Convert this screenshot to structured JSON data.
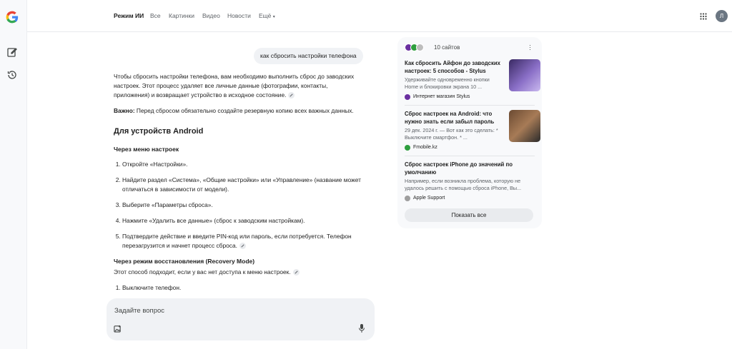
{
  "nav": {
    "tabs": [
      "Режим ИИ",
      "Все",
      "Картинки",
      "Видео",
      "Новости",
      "Ещё"
    ],
    "avatar_letter": "Л"
  },
  "query": "как сбросить настройки телефона",
  "answer": {
    "intro": "Чтобы сбросить настройки телефона, вам необходимо выполнить сброс до заводских настроек. Этот процесс удаляет все личные данные (фотографии, контакты, приложения) и возвращает устройство в исходное состояние.",
    "important_label": "Важно:",
    "important_text": " Перед сбросом обязательно создайте резервную копию всех важных данных.",
    "android_heading": "Для устройств Android",
    "menu_heading": "Через меню настроек",
    "steps": [
      "Откройте «Настройки».",
      "Найдите раздел «Система», «Общие настройки» или «Управление» (название может отличаться в зависимости от модели).",
      "Выберите «Параметры сброса».",
      "Нажмите «Удалить все данные» (сброс к заводским настройкам).",
      "Подтвердите действие и введите PIN-код или пароль, если потребуется. Телефон перезагрузится и начнет процесс сброса."
    ],
    "recovery_heading": "Через режим восстановления (Recovery Mode)",
    "recovery_intro": "Этот способ подходит, если у вас нет доступа к меню настроек.",
    "recovery_step1": "Выключите телефон."
  },
  "input": {
    "placeholder": "Задайте вопрос"
  },
  "sources": {
    "count_label": "10 сайтов",
    "cards": [
      {
        "title": "Как сбросить Айфон до заводских настроек: 5 способов - Stylus",
        "snippet": "Удерживайте одновременно кнопки Home и блокировки экрана 10 ...",
        "source": "Интернет магазин Stylus"
      },
      {
        "title": "Сброс настроек на Android: что нужно знать если забыл пароль",
        "snippet": "29 дек. 2024 г. — Вот как это сделать: * Выключите смартфон. * ...",
        "source": "Fmobile.kz"
      },
      {
        "title": "Сброс настроек iPhone до значений по умолчанию",
        "snippet": "Например, если возникла проблема, которую не удалось решить с помощью сброса iPhone, Вы...",
        "source": "Apple Support"
      }
    ],
    "show_all": "Показать все"
  },
  "colors": {
    "google_blue": "#4285F4",
    "google_red": "#EA4335",
    "google_yellow": "#FBBC05",
    "google_green": "#34A853",
    "stylus_purple": "#6a2fa0",
    "fmobile_green": "#2e9e3e"
  },
  "icons": [
    "google-logo-icon",
    "new-chat-icon",
    "history-icon",
    "apps-grid-icon",
    "add-image-icon",
    "mic-icon",
    "link-icon",
    "more-vert-icon"
  ]
}
